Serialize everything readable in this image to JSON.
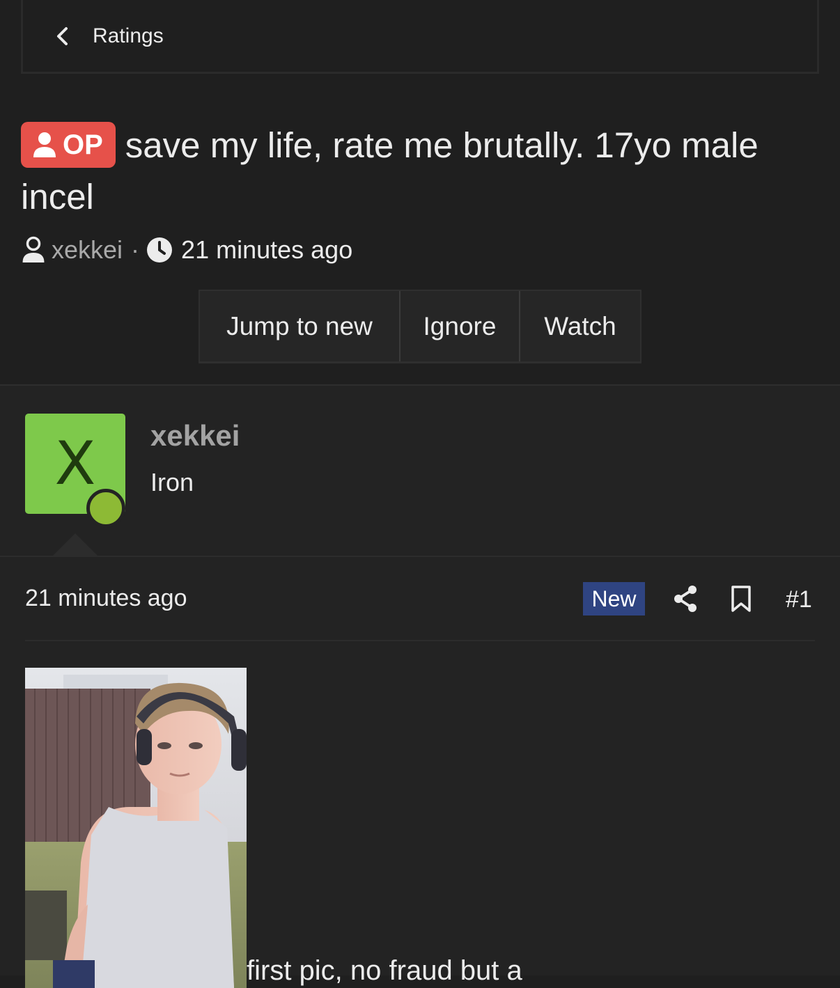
{
  "breadcrumb": {
    "label": "Ratings"
  },
  "thread": {
    "op_badge": "OP",
    "title": "save my life, rate me brutally. 17yo male incel",
    "author": "xekkei",
    "separator": "·",
    "time": "21 minutes ago"
  },
  "actions": {
    "jump_to_new": "Jump to new",
    "ignore": "Ignore",
    "watch": "Watch"
  },
  "post": {
    "avatar_letter": "X",
    "username": "xekkei",
    "user_title": "Iron",
    "time": "21 minutes ago",
    "new_badge": "New",
    "number": "#1",
    "body_text": "first pic, no fraud but a"
  },
  "colors": {
    "background": "#1f1f1f",
    "op_badge": "#e6514a",
    "avatar": "#7ec94b",
    "online": "#8dba35",
    "new_badge": "#2f4482"
  }
}
